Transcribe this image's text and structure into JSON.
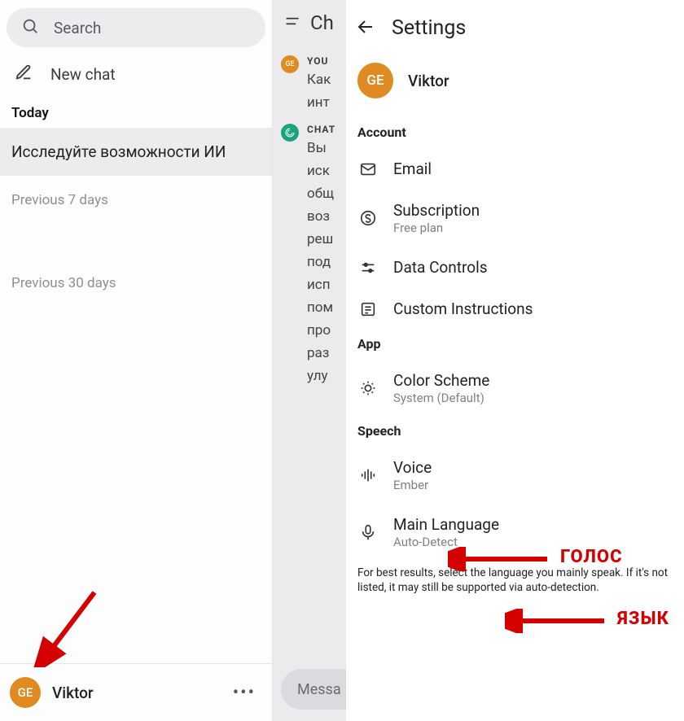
{
  "sidebar": {
    "search_placeholder": "Search",
    "new_chat_label": "New chat",
    "sections": {
      "today_label": "Today",
      "prev7_label": "Previous 7 days",
      "prev30_label": "Previous 30 days"
    },
    "today_items": [
      {
        "title": "Исследуйте возможности ИИ"
      }
    ],
    "footer_user": "Viktor",
    "footer_avatar_initials": "GE"
  },
  "chat": {
    "title_fragment": "Ch",
    "user_sender": "YOU",
    "user_avatar_initials": "GE",
    "user_msg_fragment": "Как\nинт",
    "assistant_sender": "CHAT",
    "assistant_msg_fragment": "Вы\nиск\nобщ\nвоз\nреш\nпод\nисп\nпом\nпро\nраз\nулу",
    "composer_placeholder": "Messa"
  },
  "settings": {
    "header_title": "Settings",
    "profile_name": "Viktor",
    "profile_initials": "GE",
    "groups": {
      "account_label": "Account",
      "app_label": "App",
      "speech_label": "Speech"
    },
    "items": {
      "email": {
        "title": "Email"
      },
      "subscription": {
        "title": "Subscription",
        "subtitle": "Free plan"
      },
      "data_controls": {
        "title": "Data Controls"
      },
      "custom_instructions": {
        "title": "Custom Instructions"
      },
      "color_scheme": {
        "title": "Color Scheme",
        "subtitle": "System (Default)"
      },
      "voice": {
        "title": "Voice",
        "subtitle": "Ember"
      },
      "main_language": {
        "title": "Main Language",
        "subtitle": "Auto-Detect"
      }
    },
    "fine_print": "For best results, select the language you mainly speak. If it's not listed, it may still be supported via auto-detection."
  },
  "annotations": {
    "voice_label": "ГОЛОС",
    "language_label": "ЯЗЫК"
  }
}
